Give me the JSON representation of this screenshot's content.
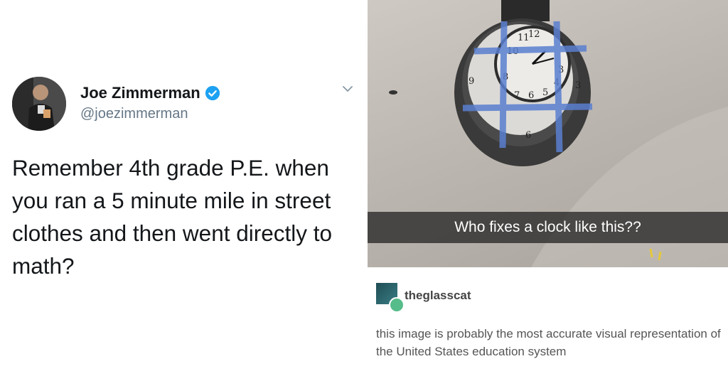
{
  "tweet": {
    "display_name": "Joe Zimmerman",
    "handle": "@joezimmerman",
    "text": "Remember 4th grade P.E. when you ran a 5 minute mile in street clothes and then went directly to math?",
    "verified_color": "#1da1f2"
  },
  "photo": {
    "caption": "Who fixes a clock like this??",
    "clock_numbers": [
      "12",
      "11",
      "10",
      "9",
      "8",
      "7",
      "6",
      "5",
      "4",
      "3",
      "6",
      "3"
    ]
  },
  "comment": {
    "username": "theglasscat",
    "text": "this image is probably the most accurate visual representation of the United States education system"
  }
}
